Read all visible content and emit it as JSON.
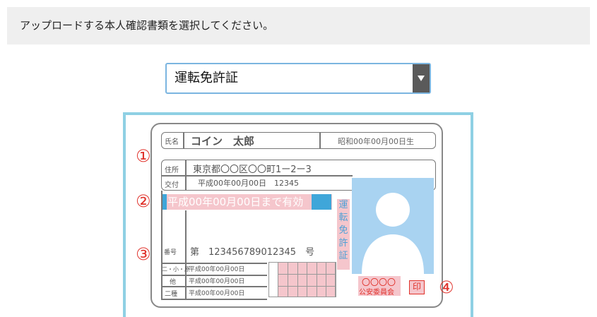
{
  "instruction": "アップロードする本人確認書類を選択してください。",
  "document_select": {
    "selected": "運転免許証"
  },
  "license": {
    "name_label": "氏名",
    "name_value": "コイン　太郎",
    "birth": "昭和00年00月00日生",
    "address_label": "住所",
    "address_value": "東京都〇〇区〇〇町1ー2ー3",
    "issue_label": "交付",
    "issue_value": "平成00年00月00日　12345",
    "validity": "平成00年00月00日まで有効",
    "number_label": "番号",
    "number_value": "第　123456789012345　号",
    "class_rows": [
      {
        "label": "二・小・原",
        "date": "平成00年00月00日"
      },
      {
        "label": "他",
        "date": "平成00年00月00日"
      },
      {
        "label": "二種",
        "date": "平成00年00月00日"
      }
    ],
    "vertical_title": [
      "運",
      "転",
      "免",
      "許",
      "証"
    ],
    "commission_top": "〇〇〇〇",
    "commission_bottom": "公安委員会",
    "stamp": "印",
    "markers": [
      "①",
      "②",
      "③",
      "④"
    ]
  },
  "colors": {
    "accent_red": "#e0322b",
    "highlight_pink": "#f5c6cc",
    "highlight_blue": "#3fa6d9",
    "photo_blue": "#a9d3f1"
  }
}
